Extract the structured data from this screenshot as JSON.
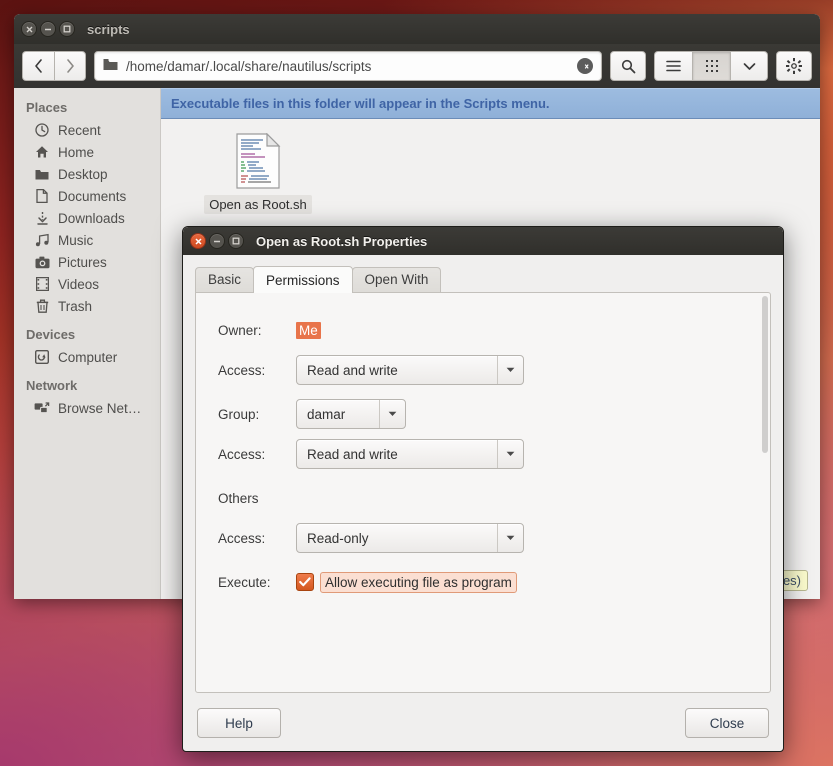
{
  "window": {
    "title": "scripts",
    "controls": {
      "close": "close-icon",
      "minimize": "minimize-icon",
      "maximize": "maximize-icon"
    }
  },
  "toolbar": {
    "back_label": "‹",
    "forward_label": "›",
    "path": "/home/damar/.local/share/nautilus/scripts",
    "clear_label": "⌫",
    "search_label": "search-icon",
    "list_view_label": "list-view-icon",
    "grid_view_label": "grid-view-icon",
    "view_menu_label": "chevron-down-icon",
    "settings_label": "gear-icon"
  },
  "sidebar": {
    "sections": [
      {
        "heading": "Places",
        "items": [
          {
            "label": "Recent",
            "icon": "clock-icon"
          },
          {
            "label": "Home",
            "icon": "home-icon"
          },
          {
            "label": "Desktop",
            "icon": "folder-icon"
          },
          {
            "label": "Documents",
            "icon": "document-icon"
          },
          {
            "label": "Downloads",
            "icon": "download-icon"
          },
          {
            "label": "Music",
            "icon": "music-icon"
          },
          {
            "label": "Pictures",
            "icon": "camera-icon"
          },
          {
            "label": "Videos",
            "icon": "film-icon"
          },
          {
            "label": "Trash",
            "icon": "trash-icon"
          }
        ]
      },
      {
        "heading": "Devices",
        "items": [
          {
            "label": "Computer",
            "icon": "computer-icon"
          }
        ]
      },
      {
        "heading": "Network",
        "items": [
          {
            "label": "Browse Net…",
            "icon": "network-icon"
          }
        ]
      }
    ]
  },
  "file_area": {
    "infobar_message": "Executable files in this folder will appear in the Scripts menu.",
    "files": [
      {
        "name": "Open as Root.sh",
        "icon": "script-file-icon"
      }
    ],
    "status_text": "es)"
  },
  "dialog": {
    "title": "Open as Root.sh Properties",
    "tabs": [
      {
        "label": "Basic",
        "selected": false
      },
      {
        "label": "Permissions",
        "selected": true
      },
      {
        "label": "Open With",
        "selected": false
      }
    ],
    "permissions": {
      "owner_label": "Owner:",
      "owner_value": "Me",
      "owner_access_label": "Access:",
      "owner_access_value": "Read and write",
      "group_label": "Group:",
      "group_value": "damar",
      "group_access_label": "Access:",
      "group_access_value": "Read and write",
      "others_label": "Others",
      "others_access_label": "Access:",
      "others_access_value": "Read-only",
      "execute_label": "Execute:",
      "execute_checkbox_label": "Allow executing file as program",
      "execute_checked": true
    },
    "footer": {
      "help_label": "Help",
      "close_label": "Close"
    }
  },
  "colors": {
    "accent_orange": "#e8744a",
    "checkbox_orange": "#d4571f",
    "infobar_blue": "#9dbce0",
    "infobar_text": "#3f64a5",
    "titlebar_dark": "#35342f",
    "sidebar_bg": "#e2e0dd",
    "highlight_pink": "#fbdfd2"
  }
}
